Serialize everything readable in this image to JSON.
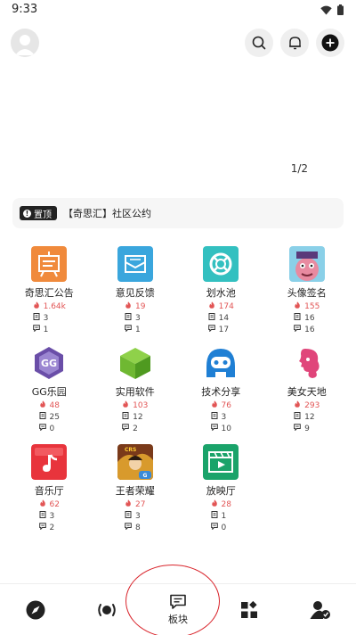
{
  "status_bar": {
    "time": "9:33"
  },
  "banner": {
    "indicator": "1/2"
  },
  "notice": {
    "tag": "置顶",
    "text": "【奇思汇】社区公约"
  },
  "forums": [
    {
      "name": "奇思汇公告",
      "hot": "1.64k",
      "posts": "3",
      "comments": "1",
      "icon": "notice-board-icon",
      "color": "#f08a3c"
    },
    {
      "name": "意见反馈",
      "hot": "19",
      "posts": "3",
      "comments": "1",
      "icon": "mail-icon",
      "color": "#3aa6dd"
    },
    {
      "name": "划水池",
      "hot": "174",
      "posts": "14",
      "comments": "17",
      "icon": "lifebuoy-icon",
      "color": "#33c0c0"
    },
    {
      "name": "头像签名",
      "hot": "155",
      "posts": "16",
      "comments": "16",
      "icon": "avatar-art-icon",
      "color": "#e88aa0"
    },
    {
      "name": "GG乐园",
      "hot": "48",
      "posts": "25",
      "comments": "0",
      "icon": "gg-logo-icon",
      "color": "#6a4ea8"
    },
    {
      "name": "实用软件",
      "hot": "103",
      "posts": "12",
      "comments": "2",
      "icon": "cube-icon",
      "color": "#6fb832"
    },
    {
      "name": "技术分享",
      "hot": "76",
      "posts": "3",
      "comments": "10",
      "icon": "robot-icon",
      "color": "#1f7fd4"
    },
    {
      "name": "美女天地",
      "hot": "293",
      "posts": "12",
      "comments": "9",
      "icon": "woman-profile-icon",
      "color": "#e0457a"
    },
    {
      "name": "音乐厅",
      "hot": "62",
      "posts": "3",
      "comments": "2",
      "icon": "music-note-icon",
      "color": "#e8343c"
    },
    {
      "name": "王者荣耀",
      "hot": "27",
      "posts": "3",
      "comments": "8",
      "icon": "game-hero-icon",
      "color": "#d89a2c"
    },
    {
      "name": "放映厅",
      "hot": "28",
      "posts": "1",
      "comments": "0",
      "icon": "clapperboard-icon",
      "color": "#1aa36a"
    }
  ],
  "bottom_nav": [
    {
      "id": "discover",
      "label": "",
      "icon": "compass-icon"
    },
    {
      "id": "broadcast",
      "label": "",
      "icon": "broadcast-icon"
    },
    {
      "id": "boards",
      "label": "板块",
      "icon": "chat-board-icon"
    },
    {
      "id": "apps",
      "label": "",
      "icon": "apps-grid-icon"
    },
    {
      "id": "profile",
      "label": "",
      "icon": "user-verified-icon"
    }
  ],
  "colors": {
    "hot": "#e25555",
    "annotation": "#d9252c"
  }
}
